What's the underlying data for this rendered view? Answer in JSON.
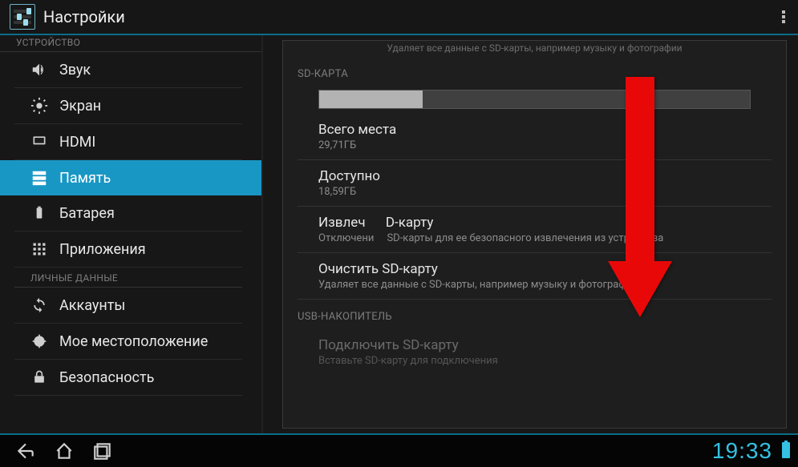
{
  "header": {
    "title": "Настройки"
  },
  "sidebar": {
    "section_device": "УСТРОЙСТВО",
    "section_personal": "ЛИЧНЫЕ ДАННЫЕ",
    "items": {
      "sound": "Звук",
      "display": "Экран",
      "hdmi": "HDMI",
      "storage": "Память",
      "battery": "Батарея",
      "apps": "Приложения",
      "accounts": "Аккаунты",
      "location": "Мое местоположение",
      "security": "Безопасность"
    }
  },
  "content": {
    "truncated_top": "Удаляет все данные с SD-карты, например музыку и фотографии",
    "sd_section": "SD-КАРТА",
    "total": {
      "title": "Всего места",
      "value": "29,71ГБ"
    },
    "avail": {
      "title": "Доступно",
      "value": "18,59ГБ"
    },
    "unmount": {
      "title_pre": "Извлеч",
      "title_post": "D-карту",
      "sub_pre": "Отключени",
      "sub_post": "SD-карты для ее безопасного извлечения из устройства"
    },
    "erase": {
      "title": "Очистить SD-карту",
      "sub": "Удаляет все данные с SD-карты, например музыку и фотографии"
    },
    "usb_section": "USB-НАКОПИТЕЛЬ",
    "mount": {
      "title": "Подключить SD-карту",
      "sub": "Вставьте SD-карту для подключения"
    }
  },
  "clock": "19:33"
}
